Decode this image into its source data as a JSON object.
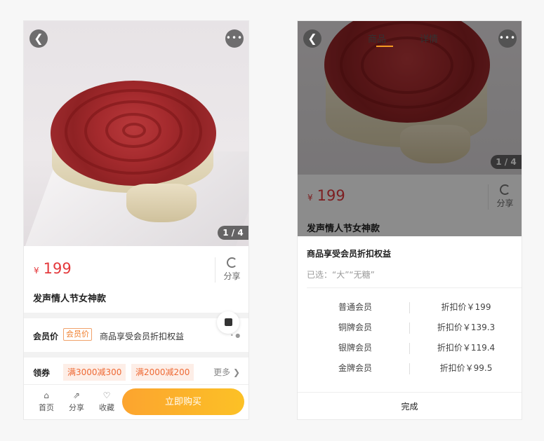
{
  "left": {
    "image_counter": "1 / 4",
    "price": {
      "currency": "¥",
      "amount": "199"
    },
    "share_label": "分享",
    "product_title": "发声情人节女神款",
    "member": {
      "label": "会员价",
      "tag": "会员价",
      "text": "商品享受会员折扣权益"
    },
    "coupons": {
      "label": "领券",
      "items": [
        "满3000减300",
        "满2000减200"
      ],
      "more": "更多 ❯"
    },
    "bottom_nav": [
      {
        "icon": "store-icon",
        "label": "首页"
      },
      {
        "icon": "share-icon",
        "label": "分享"
      },
      {
        "icon": "heart-icon",
        "label": "收藏"
      }
    ],
    "buy_button": "立即购买",
    "back_glyph": "❮",
    "more_glyph": "•••"
  },
  "right": {
    "tabs": [
      "商品",
      "详情"
    ],
    "image_counter": "1 / 4",
    "price": {
      "currency": "¥",
      "amount": "199"
    },
    "share_label": "分享",
    "product_title": "发声情人节女神款",
    "sheet": {
      "title": "商品享受会员折扣权益",
      "selected": "已选：“大”“无糖”",
      "tiers": [
        {
          "name": "普通会员",
          "discount": "折扣价￥199"
        },
        {
          "name": "铜牌会员",
          "discount": "折扣价￥139.3"
        },
        {
          "name": "银牌会员",
          "discount": "折扣价￥119.4"
        },
        {
          "name": "金牌会员",
          "discount": "折扣价￥99.5"
        }
      ],
      "done_button": "完成"
    }
  },
  "colors": {
    "price_red": "#e4393c",
    "accent_orange": "#fcaa2c",
    "tag_orange": "#f07d2a"
  }
}
